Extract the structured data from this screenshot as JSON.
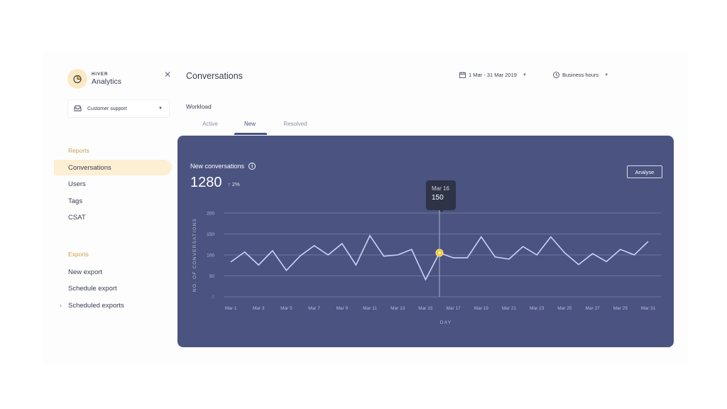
{
  "sidebar": {
    "brand_small": "HIVER",
    "brand_big": "Analytics",
    "team_select": {
      "value": "Customer support"
    },
    "sections": [
      {
        "title": "Reports",
        "items": [
          {
            "label": "Conversations",
            "active": true
          },
          {
            "label": "Users"
          },
          {
            "label": "Tags"
          },
          {
            "label": "CSAT"
          }
        ]
      },
      {
        "title": "Exports",
        "items": [
          {
            "label": "New export"
          },
          {
            "label": "Schedule export"
          },
          {
            "label": "Scheduled exports",
            "expandable": true
          }
        ]
      }
    ]
  },
  "header": {
    "title": "Conversations",
    "date_range": "1 Mar - 31 Mar 2019",
    "hours_filter": "Business hours"
  },
  "workload": {
    "label": "Workload",
    "tabs": [
      {
        "label": "Active"
      },
      {
        "label": "New",
        "active": true
      },
      {
        "label": "Resolved"
      }
    ]
  },
  "card": {
    "title": "New conversations",
    "total": "1280",
    "delta": "2%",
    "analyse_label": "Analyse",
    "tooltip": {
      "date": "Mar 16",
      "value": "150"
    }
  },
  "colors": {
    "card_bg": "#4b5380",
    "line": "#c8d4f5",
    "highlight_point": "#f5c431",
    "accent": "#c9a04a",
    "active_nav_bg": "#fdefd3"
  },
  "chart_data": {
    "type": "line",
    "title": "New conversations",
    "xlabel": "DAY",
    "ylabel": "NO. OF CONVERSATIONS",
    "ylim": [
      0,
      200
    ],
    "yticks": [
      0,
      50,
      100,
      150,
      200
    ],
    "grid": true,
    "x": [
      "Mar 1",
      "Mar 2",
      "Mar 3",
      "Mar 4",
      "Mar 5",
      "Mar 6",
      "Mar 7",
      "Mar 8",
      "Mar 9",
      "Mar 10",
      "Mar 11",
      "Mar 12",
      "Mar 13",
      "Mar 14",
      "Mar 15",
      "Mar 16",
      "Mar 17",
      "Mar 18",
      "Mar 19",
      "Mar 20",
      "Mar 21",
      "Mar 22",
      "Mar 23",
      "Mar 24",
      "Mar 25",
      "Mar 26",
      "Mar 27",
      "Mar 28",
      "Mar 29",
      "Mar 30",
      "Mar 31"
    ],
    "xtick_labels": [
      "Mar 1",
      "Mar 3",
      "Mar 5",
      "Mar 7",
      "Mar 9",
      "Mar 11",
      "Mar 13",
      "Mar 15",
      "Mar 17",
      "Mar 19",
      "Mar 21",
      "Mar 23",
      "Mar 25",
      "Mar 27",
      "Mar 29",
      "Mar 31"
    ],
    "series": [
      {
        "name": "New conversations",
        "values": [
          83,
          107,
          76,
          110,
          63,
          98,
          122,
          100,
          127,
          76,
          146,
          97,
          100,
          113,
          41,
          105,
          93,
          93,
          143,
          95,
          90,
          120,
          100,
          143,
          105,
          77,
          103,
          84,
          113,
          100,
          132
        ]
      }
    ],
    "highlight": {
      "x": "Mar 16",
      "tooltip_value": 150
    }
  }
}
